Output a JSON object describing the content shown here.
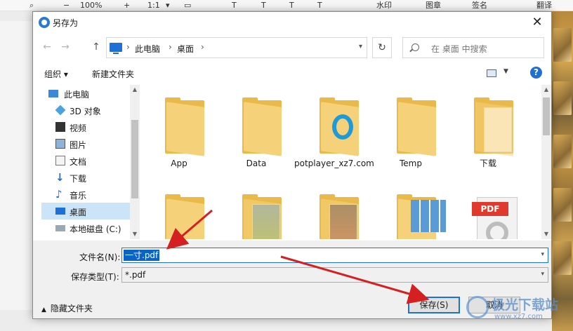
{
  "app": {
    "zoom": "100%",
    "zoom_ratio": "1:1",
    "watermark_tool": "水印",
    "stamp_tool": "图章",
    "sign_tool": "签名",
    "translate_tool": "翻译"
  },
  "dialog": {
    "title": "另存为",
    "close_glyph": "✕",
    "address": {
      "parts": [
        "此电脑",
        "桌面"
      ]
    },
    "search_placeholder": "在 桌面 中搜索",
    "organize_label": "组织",
    "new_folder_label": "新建文件夹",
    "help_label": "?",
    "nav_items": [
      {
        "label": "此电脑",
        "icon": "computer-icon"
      },
      {
        "label": "3D 对象",
        "icon": "3d-objects-icon"
      },
      {
        "label": "视频",
        "icon": "videos-icon"
      },
      {
        "label": "图片",
        "icon": "pictures-icon"
      },
      {
        "label": "文档",
        "icon": "documents-icon"
      },
      {
        "label": "下载",
        "icon": "downloads-icon"
      },
      {
        "label": "音乐",
        "icon": "music-icon"
      },
      {
        "label": "桌面",
        "icon": "desktop-icon",
        "selected": true
      },
      {
        "label": "本地磁盘 (C:)",
        "icon": "drive-icon"
      }
    ],
    "files": [
      {
        "label": "App",
        "icon": "folder-icon"
      },
      {
        "label": "Data",
        "icon": "folder-icon"
      },
      {
        "label": "potplayer_xz7.com",
        "icon": "folder-icon"
      },
      {
        "label": "Temp",
        "icon": "folder-icon"
      },
      {
        "label": "下载",
        "icon": "folder-icon"
      },
      {
        "label": "",
        "icon": "folder-icon"
      },
      {
        "label": "",
        "icon": "folder-icon"
      },
      {
        "label": "",
        "icon": "folder-icon"
      },
      {
        "label": "",
        "icon": "image-folder-icon"
      },
      {
        "label": "",
        "icon": "pdf-file-icon"
      }
    ],
    "pdf_badge": "PDF",
    "filename_label": "文件名(N):",
    "filename_value": "一寸.pdf",
    "filetype_label": "保存类型(T):",
    "filetype_value": "*.pdf",
    "hide_folders_label": "隐藏文件夹",
    "save_label": "保存(S)",
    "cancel_label": "取消"
  },
  "watermark": {
    "text": "极光下载站",
    "url": "www.xz7.com"
  },
  "colors": {
    "accent": "#1e6fd6",
    "selection": "#cce4f7",
    "folder": "#e9b94a",
    "arrow": "#d42020"
  }
}
